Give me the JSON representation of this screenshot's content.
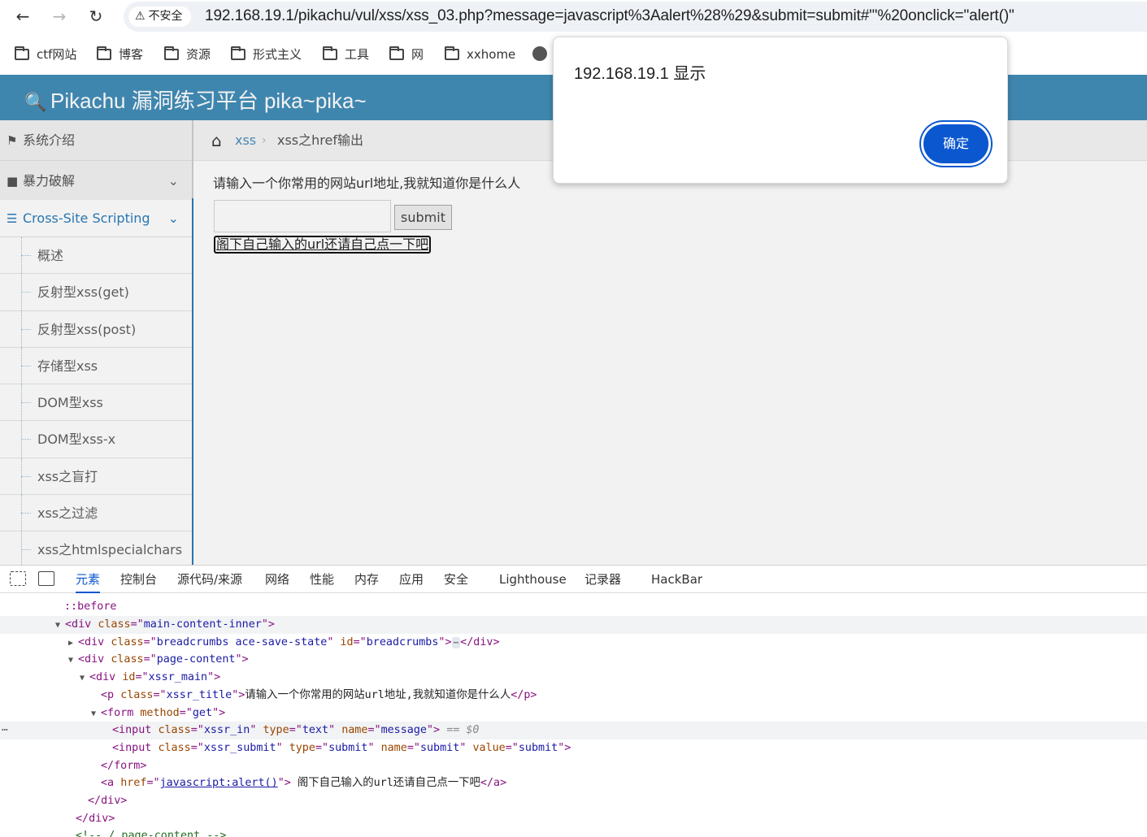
{
  "browser": {
    "security_label": "不安全",
    "url": "192.168.19.1/pikachu/vul/xss/xss_03.php?message=javascript%3Aalert%28%29&submit=submit#\"'%20onclick=\"alert()\"",
    "bookmarks": [
      "ctf网站",
      "博客",
      "资源",
      "形式主义",
      "工具",
      "网",
      "xxhome"
    ]
  },
  "app": {
    "brand": "Pikachu 漏洞练习平台 pika~pika~"
  },
  "sidebar": {
    "items": [
      "系统介绍",
      "暴力破解",
      "Cross-Site Scripting"
    ],
    "sub_items": [
      "概述",
      "反射型xss(get)",
      "反射型xss(post)",
      "存储型xss",
      "DOM型xss",
      "DOM型xss-x",
      "xss之盲打",
      "xss之过滤",
      "xss之htmlspecialchars"
    ]
  },
  "breadcrumbs": {
    "link": "xss",
    "current": "xss之href输出"
  },
  "main": {
    "title": "请输入一个你常用的网站url地址,我就知道你是什么人",
    "input_value": "",
    "submit_label": "submit",
    "link_text": "阁下自己输入的url还请自己点一下吧"
  },
  "alert": {
    "title": "192.168.19.1 显示",
    "ok_label": "确定"
  },
  "devtools": {
    "tabs": [
      "元素",
      "控制台",
      "源代码/来源",
      "网络",
      "性能",
      "内存",
      "应用",
      "安全",
      "Lighthouse",
      "记录器",
      "HackBar"
    ],
    "dom": {
      "before": "::before",
      "main_inner_cls": "main-content-inner",
      "breadcrumbs_cls": "breadcrumbs ace-save-state",
      "breadcrumbs_id": "breadcrumbs",
      "page_content_cls": "page-content",
      "xssr_main_id": "xssr_main",
      "p_cls": "xssr_title",
      "p_text": "请输入一个你常用的网站url地址,我就知道你是什么人",
      "form_method": "get",
      "input1_cls": "xssr_in",
      "input1_type": "text",
      "input1_name": "message",
      "eq_label": "== $0",
      "input2_cls": "xssr_submit",
      "input2_type": "submit",
      "input2_name": "submit",
      "input2_value": "submit",
      "a_href": "javascript:alert()",
      "a_text": " 阁下自己输入的url还请自己点一下吧",
      "comment": "<!-- /.page-content -->"
    }
  }
}
